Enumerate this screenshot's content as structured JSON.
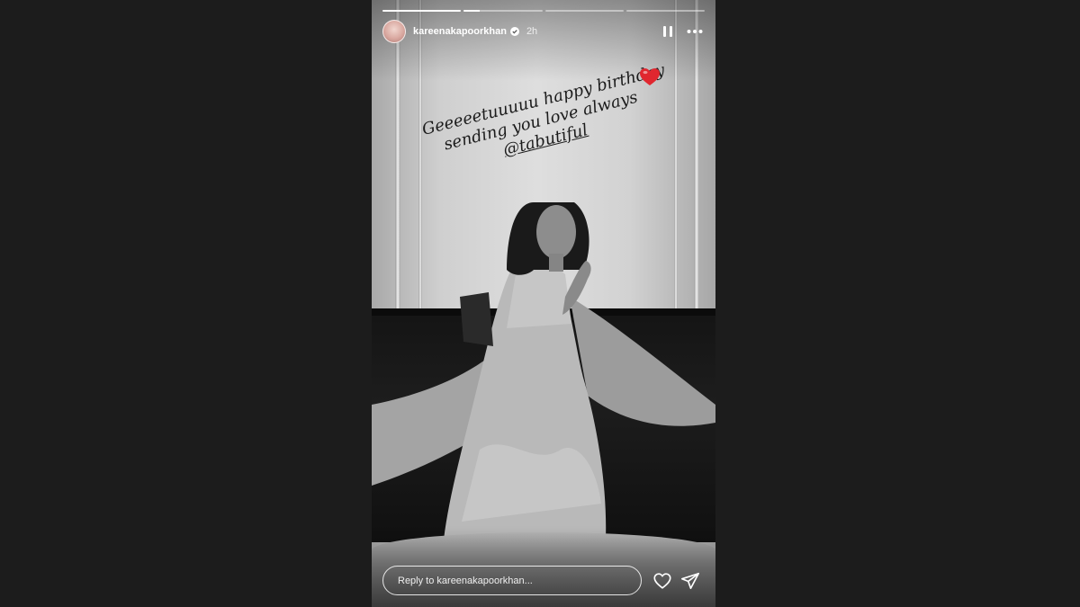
{
  "story": {
    "username": "kareenakapoorkhan",
    "time": "2h",
    "verified": true,
    "progress": [
      1.0,
      0.2,
      0.0,
      0.0
    ],
    "caption": {
      "line1": "Geeeeetuuuuu happy birthday",
      "line2": "sending you love always",
      "mention": "@tabutiful"
    },
    "sticker": "red-heart-emoji"
  },
  "reply": {
    "placeholder": "Reply to kareenakapoorkhan..."
  },
  "icons": {
    "pause": "pause-icon",
    "more": "more-icon",
    "like": "heart-icon",
    "share": "send-icon",
    "verified": "verified-badge-icon"
  },
  "colors": {
    "background": "#1c1c1c",
    "verified_badge": "#ffffff",
    "heart": "#e0272f"
  }
}
